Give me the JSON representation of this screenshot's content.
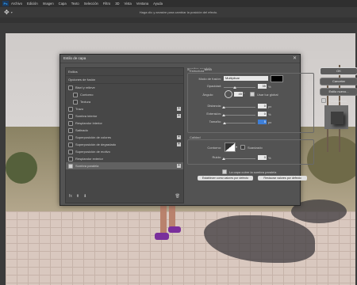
{
  "menu": {
    "items": [
      "Archivo",
      "Edición",
      "Imagen",
      "Capa",
      "Texto",
      "Selección",
      "Filtro",
      "3D",
      "Vista",
      "Ventana",
      "Ayuda"
    ]
  },
  "options_bar": {
    "hint": "Haga clic y arrastre para cambiar la posición del efecto."
  },
  "dialog": {
    "title": "Estilo de capa",
    "close": "✕",
    "styles": [
      {
        "label": "Estilos",
        "checkbox": false,
        "checked": false,
        "plus": false,
        "sep": true
      },
      {
        "label": "Opciones de fusión",
        "checkbox": false,
        "checked": false,
        "plus": false,
        "sep": true
      },
      {
        "label": "Bisel y relieve",
        "checkbox": true,
        "checked": false,
        "plus": false,
        "sep": false
      },
      {
        "label": "Contorno",
        "checkbox": true,
        "checked": false,
        "plus": false,
        "sep": false,
        "indent": true
      },
      {
        "label": "Textura",
        "checkbox": true,
        "checked": false,
        "plus": false,
        "sep": false,
        "indent": true
      },
      {
        "label": "Trazo",
        "checkbox": true,
        "checked": false,
        "plus": true,
        "sep": false
      },
      {
        "label": "Sombra interior",
        "checkbox": true,
        "checked": false,
        "plus": true,
        "sep": false
      },
      {
        "label": "Resplandor interior",
        "checkbox": true,
        "checked": false,
        "plus": false,
        "sep": false
      },
      {
        "label": "Satinado",
        "checkbox": true,
        "checked": false,
        "plus": false,
        "sep": false
      },
      {
        "label": "Superposición de colores",
        "checkbox": true,
        "checked": false,
        "plus": true,
        "sep": false
      },
      {
        "label": "Superposición de degradado",
        "checkbox": true,
        "checked": false,
        "plus": true,
        "sep": false
      },
      {
        "label": "Superposición de motivo",
        "checkbox": true,
        "checked": false,
        "plus": false,
        "sep": false
      },
      {
        "label": "Resplandor exterior",
        "checkbox": true,
        "checked": false,
        "plus": false,
        "sep": false
      },
      {
        "label": "Sombra paralela",
        "checkbox": true,
        "checked": true,
        "plus": true,
        "sep": false,
        "selected": true
      }
    ],
    "footer": {
      "fx": "fx",
      "up": "⬆",
      "down": "⬇",
      "trash": "🗑"
    },
    "settings": {
      "section": "Sombra paralela",
      "structure": "Estructura",
      "blend_mode_label": "Modo de fusión:",
      "blend_mode_value": "Multiplicar",
      "shadow_color": "#000000",
      "opacity_label": "Opacidad:",
      "opacity_value": "35",
      "opacity_fraction": 0.35,
      "angle_label": "Ángulo:",
      "angle_value": "45",
      "global_light_label": "Usar luz global",
      "distance_label": "Distancia:",
      "distance_value": "0",
      "distance_fraction": 0.0,
      "spread_label": "Extensión:",
      "spread_value": "0",
      "spread_fraction": 0.0,
      "size_label": "Tamaño:",
      "size_value": "5",
      "size_fraction": 0.02,
      "pct": "%",
      "px": "px",
      "deg": "°",
      "quality": "Calidad",
      "contour_label": "Contorno:",
      "antialias_label": "Suavizado",
      "noise_label": "Ruido:",
      "noise_value": "0",
      "noise_fraction": 0.0,
      "knockout_label": "La capa cubre la sombra paralela",
      "make_default": "Establecer como valores por defecto",
      "reset_default": "Restaurar valores por defecto"
    },
    "buttons": {
      "ok": "OK",
      "cancel": "Cancelar",
      "new_style": "Estilo nuevo...",
      "preview": "Previsualizar"
    }
  }
}
